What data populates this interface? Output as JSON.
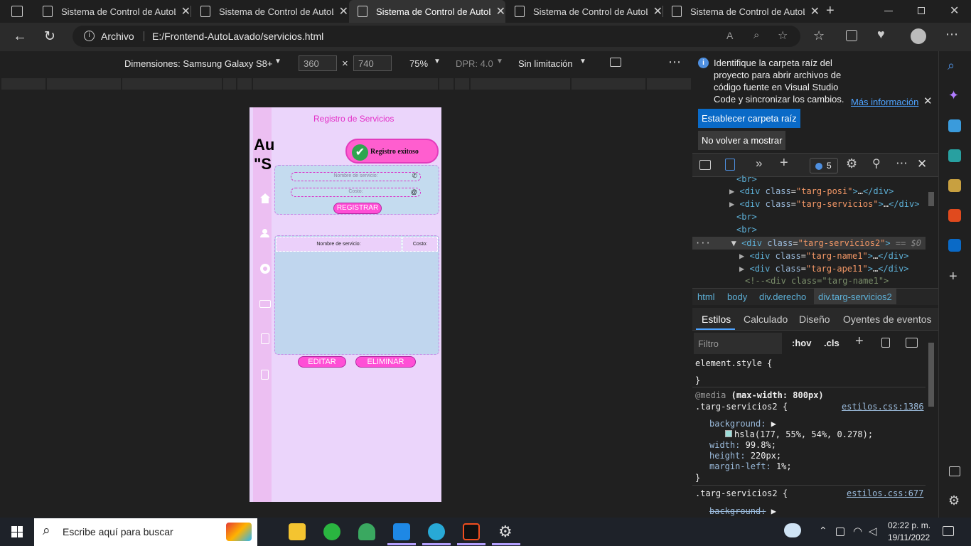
{
  "tabs": [
    {
      "title": "Sistema de Control de AutoLavado"
    },
    {
      "title": "Sistema de Control de AutoLavado"
    },
    {
      "title": "Sistema de Control de AutoLavado"
    },
    {
      "title": "Sistema de Control de AutoLavado"
    },
    {
      "title": "Sistema de Control de AutoLavado"
    }
  ],
  "address": {
    "origin_label": "Archivo",
    "url": "E:/Frontend-AutoLavado/servicios.html"
  },
  "device_bar": {
    "device": "Dimensiones: Samsung Galaxy S8+",
    "width": "360",
    "times": "×",
    "height": "740",
    "zoom": "75%",
    "dpr": "DPR: 4.0",
    "throttle": "Sin limitación"
  },
  "phone": {
    "header": "Registro de Servicios",
    "title_frag1": "Au",
    "title_frag2": "\"S",
    "toast": "Registro exitoso",
    "name_placeholder": "Nombre de servicio:",
    "cost_placeholder": "Costo:",
    "register_btn": "REGISTRAR",
    "col_name": "Nombre de servicio:",
    "col_cost": "Costo:",
    "edit_btn": "EDITAR",
    "delete_btn": "ELIMINAR"
  },
  "infobar": {
    "message": "Identifique la carpeta raíz del proyecto para abrir archivos de código fuente en Visual Studio Code y sincronizar los cambios.",
    "more_link": "Más información",
    "set_root_btn": "Establecer carpeta raíz",
    "dismiss_btn": "No volver a mostrar"
  },
  "devtools": {
    "issues_count": "5",
    "dom": [
      {
        "open": "<br>"
      },
      {
        "tag": "div",
        "cls": "targ-posi"
      },
      {
        "tag": "div",
        "cls": "targ-servicios"
      },
      {
        "open": "<br>"
      },
      {
        "open": "<br>"
      },
      {
        "tag": "div",
        "cls": "targ-servicios2",
        "marker": "== $0"
      },
      {
        "tag": "div",
        "cls": "targ-name1"
      },
      {
        "tag": "div",
        "cls": "targ-ape11"
      },
      {
        "comment": "<!--<div class=\"targ-name1\">"
      }
    ],
    "breadcrumbs": [
      "html",
      "body",
      "div.derecho",
      "div.targ-servicios2"
    ],
    "panel_tabs": [
      "Estilos",
      "Calculado",
      "Diseño",
      "Oyentes de eventos"
    ],
    "filter_placeholder": "Filtro",
    "hov": ":hov",
    "cls": ".cls",
    "rules": {
      "element_style": "element.style {",
      "close": "}",
      "media": "@media",
      "media_query": "(max-width: 800px)",
      "selector": ".targ-servicios2 {",
      "source1": "estilos.css:1386",
      "prop_bg": "background:",
      "bg_val": "hsla(177, 55%, 54%, 0.278);",
      "prop_w": "width:",
      "w_val": "99.8%;",
      "prop_h": "height:",
      "h_val": "220px;",
      "prop_ml": "margin-left:",
      "ml_val": "1%;",
      "selector2": ".targ-servicios2 {",
      "source2": "estilos.css:677",
      "prop_bg2": "background:"
    }
  },
  "taskbar": {
    "search": "Escribe aquí para buscar",
    "time": "02:22 p. m.",
    "date": "19/11/2022"
  },
  "colors": {
    "pink": "#ff4fd6",
    "phone_bg": "#ebd5fb",
    "panel_blue": "#c6dfef",
    "link": "#4ea3ff",
    "primary_btn": "#0a6ac7"
  }
}
